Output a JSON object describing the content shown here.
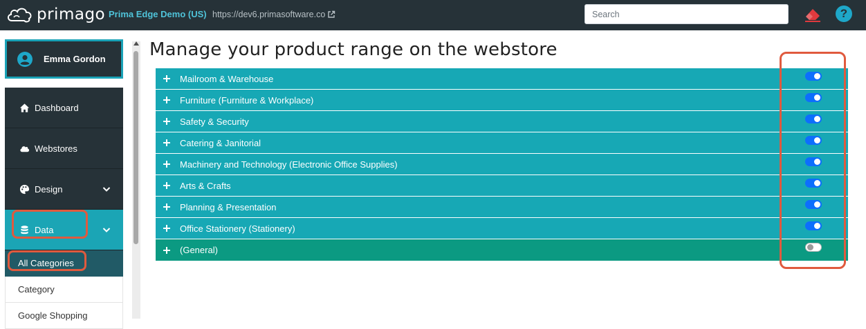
{
  "header": {
    "logo_text": "primago",
    "company": "Prima Edge Demo (US)",
    "site_url": "https://dev6.primasoftware.co",
    "search_placeholder": "Search",
    "help_label": "?"
  },
  "user": {
    "name": "Emma Gordon"
  },
  "sidebar": {
    "items": [
      {
        "label": "Dashboard",
        "icon": "home-icon"
      },
      {
        "label": "Webstores",
        "icon": "cloud-icon"
      },
      {
        "label": "Design",
        "icon": "palette-icon",
        "expandable": true
      },
      {
        "label": "Data",
        "icon": "database-icon",
        "expandable": true,
        "active": true
      }
    ],
    "sub_items": [
      {
        "label": "All Categories",
        "active": true
      },
      {
        "label": "Category"
      },
      {
        "label": "Google Shopping"
      }
    ]
  },
  "main": {
    "title": "Manage your product range on the webstore",
    "categories": [
      {
        "label": "Mailroom & Warehouse",
        "enabled": true
      },
      {
        "label": "Furniture (Furniture & Workplace)",
        "enabled": true
      },
      {
        "label": "Safety & Security",
        "enabled": true
      },
      {
        "label": "Catering & Janitorial",
        "enabled": true
      },
      {
        "label": "Machinery and Technology (Electronic Office Supplies)",
        "enabled": true
      },
      {
        "label": "Arts & Crafts",
        "enabled": true
      },
      {
        "label": "Planning & Presentation",
        "enabled": true
      },
      {
        "label": "Office Stationery (Stationery)",
        "enabled": true
      },
      {
        "label": "(General)",
        "enabled": false
      }
    ]
  },
  "colors": {
    "topbar": "#263238",
    "accent": "#1ba5b5",
    "category_row": "#17a8b5",
    "general_row": "#0b9a82",
    "toggle_on": "#0d6efd",
    "highlight": "#e05a3e"
  }
}
